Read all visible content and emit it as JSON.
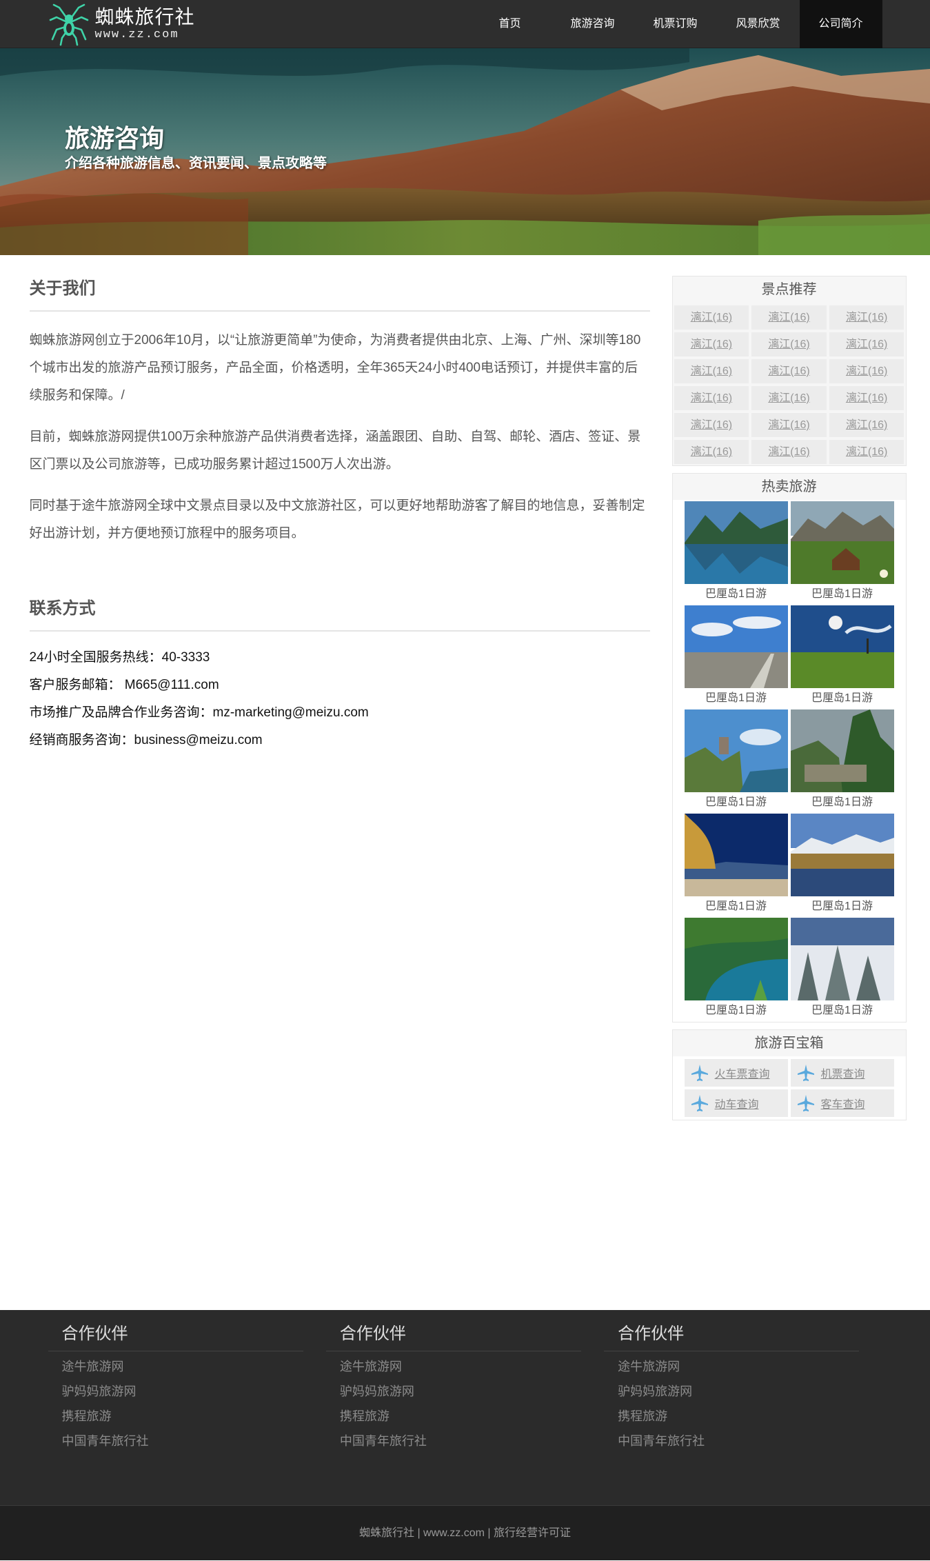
{
  "header": {
    "logo_name": "蜘蛛旅行社",
    "logo_sub": "www.zz.com",
    "nav": [
      {
        "label": "首页",
        "active": false
      },
      {
        "label": "旅游咨询",
        "active": false
      },
      {
        "label": "机票订购",
        "active": false
      },
      {
        "label": "风景欣赏",
        "active": false
      },
      {
        "label": "公司简介",
        "active": true
      }
    ]
  },
  "banner": {
    "title": "旅游咨询",
    "subtitle": "介绍各种旅游信息、资讯要闻、景点攻略等"
  },
  "about": {
    "title": "关于我们",
    "paragraphs": [
      "蜘蛛旅游网创立于2006年10月，以“让旅游更简单”为使命，为消费者提供由北京、上海、广州、深圳等180个城市出发的旅游产品预订服务，产品全面，价格透明，全年365天24小时400电话预订，并提供丰富的后续服务和保障。/",
      "目前，蜘蛛旅游网提供100万余种旅游产品供消费者选择，涵盖跟团、自助、自驾、邮轮、酒店、签证、景区门票以及公司旅游等，已成功服务累计超过1500万人次出游。",
      "同时基于途牛旅游网全球中文景点目录以及中文旅游社区，可以更好地帮助游客了解目的地信息，妥善制定好出游计划，并方便地预订旅程中的服务项目。"
    ]
  },
  "contact": {
    "title": "联系方式",
    "lines": [
      "24小时全国服务热线：40-3333",
      "客户服务邮箱： M665@111.com",
      "市场推广及品牌合作业务咨询：mz-marketing@meizu.com",
      "经销商服务咨询：business@meizu.com"
    ]
  },
  "sidebar": {
    "scenic": {
      "title": "景点推荐",
      "tags": [
        "漓江(16)",
        "漓江(16)",
        "漓江(16)",
        "漓江(16)",
        "漓江(16)",
        "漓江(16)",
        "漓江(16)",
        "漓江(16)",
        "漓江(16)",
        "漓江(16)",
        "漓江(16)",
        "漓江(16)",
        "漓江(16)",
        "漓江(16)",
        "漓江(16)",
        "漓江(16)",
        "漓江(16)",
        "漓江(16)"
      ]
    },
    "hot": {
      "title": "热卖旅游",
      "items": [
        {
          "caption": "巴厘岛1日游",
          "scene": "lake-mountain"
        },
        {
          "caption": "巴厘岛1日游",
          "scene": "meadow-hut"
        },
        {
          "caption": "巴厘岛1日游",
          "scene": "sky-road"
        },
        {
          "caption": "巴厘岛1日游",
          "scene": "moon-field"
        },
        {
          "caption": "巴厘岛1日游",
          "scene": "cliff-castle"
        },
        {
          "caption": "巴厘岛1日游",
          "scene": "mountain-ruins"
        },
        {
          "caption": "巴厘岛1日游",
          "scene": "autumn-lake"
        },
        {
          "caption": "巴厘岛1日游",
          "scene": "snow-lake"
        },
        {
          "caption": "巴厘岛1日游",
          "scene": "tropical-bay"
        },
        {
          "caption": "巴厘岛1日游",
          "scene": "snow-forest"
        }
      ]
    },
    "tools": {
      "title": "旅游百宝箱",
      "items": [
        {
          "label": "火车票查询",
          "icon": "plane-icon"
        },
        {
          "label": "机票查询",
          "icon": "plane-icon"
        },
        {
          "label": "动车查询",
          "icon": "plane-icon"
        },
        {
          "label": "客车查询",
          "icon": "plane-icon"
        }
      ],
      "icon_color": "#5aa9dd"
    }
  },
  "footer": {
    "columns": [
      {
        "title": "合作伙伴",
        "links": [
          "途牛旅游网",
          "驴妈妈旅游网",
          "携程旅游",
          "中国青年旅行社"
        ]
      },
      {
        "title": "合作伙伴",
        "links": [
          "途牛旅游网",
          "驴妈妈旅游网",
          "携程旅游",
          "中国青年旅行社"
        ]
      },
      {
        "title": "合作伙伴",
        "links": [
          "途牛旅游网",
          "驴妈妈旅游网",
          "携程旅游",
          "中国青年旅行社"
        ]
      }
    ],
    "copyright": "蜘蛛旅行社 | www.zz.com | 旅行经营许可证"
  },
  "colors": {
    "header_bg": "#2e2e2e",
    "nav_active_bg": "#111111",
    "footer_bg": "#2b2b2b",
    "logo_accent": "#3fd3a8"
  }
}
